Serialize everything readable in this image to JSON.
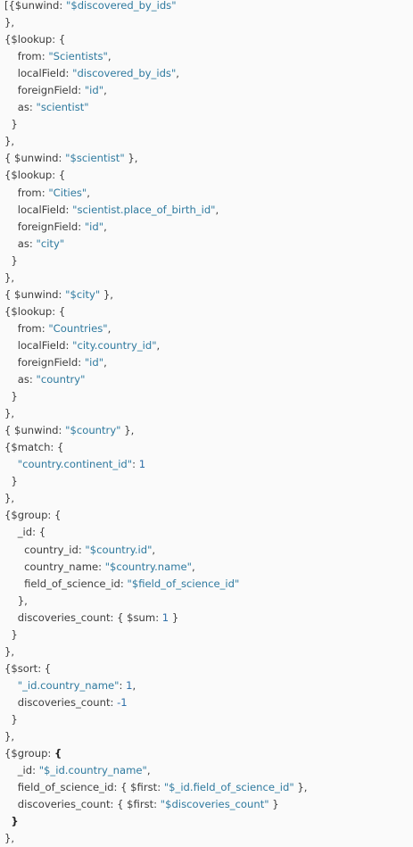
{
  "code_lines": [
    [
      {
        "t": "[{$unwind: "
      },
      {
        "t": "\"$discovered_by_ids\"",
        "c": "str"
      }
    ],
    [
      {
        "t": "},"
      }
    ],
    [
      {
        "t": "{$lookup: {"
      }
    ],
    [
      {
        "t": "    from: "
      },
      {
        "t": "\"Scientists\"",
        "c": "str"
      },
      {
        "t": ","
      }
    ],
    [
      {
        "t": "    localField: "
      },
      {
        "t": "\"discovered_by_ids\"",
        "c": "str"
      },
      {
        "t": ","
      }
    ],
    [
      {
        "t": "    foreignField: "
      },
      {
        "t": "\"id\"",
        "c": "str"
      },
      {
        "t": ","
      }
    ],
    [
      {
        "t": "    as: "
      },
      {
        "t": "\"scientist\"",
        "c": "str"
      }
    ],
    [
      {
        "t": "  }"
      }
    ],
    [
      {
        "t": "},"
      }
    ],
    [
      {
        "t": "{ $unwind: "
      },
      {
        "t": "\"$scientist\"",
        "c": "str"
      },
      {
        "t": " },"
      }
    ],
    [
      {
        "t": "{$lookup: {"
      }
    ],
    [
      {
        "t": "    from: "
      },
      {
        "t": "\"Cities\"",
        "c": "str"
      },
      {
        "t": ","
      }
    ],
    [
      {
        "t": "    localField: "
      },
      {
        "t": "\"scientist.place_of_birth_id\"",
        "c": "str"
      },
      {
        "t": ","
      }
    ],
    [
      {
        "t": "    foreignField: "
      },
      {
        "t": "\"id\"",
        "c": "str"
      },
      {
        "t": ","
      }
    ],
    [
      {
        "t": "    as: "
      },
      {
        "t": "\"city\"",
        "c": "str"
      }
    ],
    [
      {
        "t": "  }"
      }
    ],
    [
      {
        "t": "},"
      }
    ],
    [
      {
        "t": "{ $unwind: "
      },
      {
        "t": "\"$city\"",
        "c": "str"
      },
      {
        "t": " },"
      }
    ],
    [
      {
        "t": "{$lookup: {"
      }
    ],
    [
      {
        "t": "    from: "
      },
      {
        "t": "\"Countries\"",
        "c": "str"
      },
      {
        "t": ","
      }
    ],
    [
      {
        "t": "    localField: "
      },
      {
        "t": "\"city.country_id\"",
        "c": "str"
      },
      {
        "t": ","
      }
    ],
    [
      {
        "t": "    foreignField: "
      },
      {
        "t": "\"id\"",
        "c": "str"
      },
      {
        "t": ","
      }
    ],
    [
      {
        "t": "    as: "
      },
      {
        "t": "\"country\"",
        "c": "str"
      }
    ],
    [
      {
        "t": "  }"
      }
    ],
    [
      {
        "t": "},"
      }
    ],
    [
      {
        "t": "{ $unwind: "
      },
      {
        "t": "\"$country\"",
        "c": "str"
      },
      {
        "t": " },"
      }
    ],
    [
      {
        "t": "{$match: {"
      }
    ],
    [
      {
        "t": "    "
      },
      {
        "t": "\"country.continent_id\"",
        "c": "str"
      },
      {
        "t": ": "
      },
      {
        "t": "1",
        "c": "num"
      }
    ],
    [
      {
        "t": "  }"
      }
    ],
    [
      {
        "t": "},"
      }
    ],
    [
      {
        "t": "{$group: {"
      }
    ],
    [
      {
        "t": "    _id: {"
      }
    ],
    [
      {
        "t": "      country_id: "
      },
      {
        "t": "\"$country.id\"",
        "c": "str"
      },
      {
        "t": ","
      }
    ],
    [
      {
        "t": "      country_name: "
      },
      {
        "t": "\"$country.name\"",
        "c": "str"
      },
      {
        "t": ","
      }
    ],
    [
      {
        "t": "      field_of_science_id: "
      },
      {
        "t": "\"$field_of_science_id\"",
        "c": "str"
      }
    ],
    [
      {
        "t": "    },"
      }
    ],
    [
      {
        "t": "    discoveries_count: { $sum: "
      },
      {
        "t": "1",
        "c": "num"
      },
      {
        "t": " }"
      }
    ],
    [
      {
        "t": "  }"
      }
    ],
    [
      {
        "t": "},"
      }
    ],
    [
      {
        "t": "{$sort: {"
      }
    ],
    [
      {
        "t": "    "
      },
      {
        "t": "\"_id.country_name\"",
        "c": "str"
      },
      {
        "t": ": "
      },
      {
        "t": "1",
        "c": "num"
      },
      {
        "t": ","
      }
    ],
    [
      {
        "t": "    discoveries_count: "
      },
      {
        "t": "-1",
        "c": "num"
      }
    ],
    [
      {
        "t": "  }"
      }
    ],
    [
      {
        "t": "},"
      }
    ],
    [
      {
        "t": "{$group: "
      },
      {
        "t": "{",
        "c": "bold"
      }
    ],
    [
      {
        "t": "    _id: "
      },
      {
        "t": "\"$_id.country_name\"",
        "c": "str"
      },
      {
        "t": ","
      }
    ],
    [
      {
        "t": "    field_of_science_id: { $first: "
      },
      {
        "t": "\"$_id.field_of_science_id\"",
        "c": "str"
      },
      {
        "t": " },"
      }
    ],
    [
      {
        "t": "    discoveries_count: { $first: "
      },
      {
        "t": "\"$discoveries_count\"",
        "c": "str"
      },
      {
        "t": " }"
      }
    ],
    [
      {
        "t": "  "
      },
      {
        "t": "}",
        "c": "bold"
      }
    ],
    [
      {
        "t": "},"
      }
    ]
  ],
  "colors": {
    "background": "#fafafa",
    "text": "#3d3d3d",
    "string": "#2f7a9f",
    "number": "#2f6fa8"
  }
}
